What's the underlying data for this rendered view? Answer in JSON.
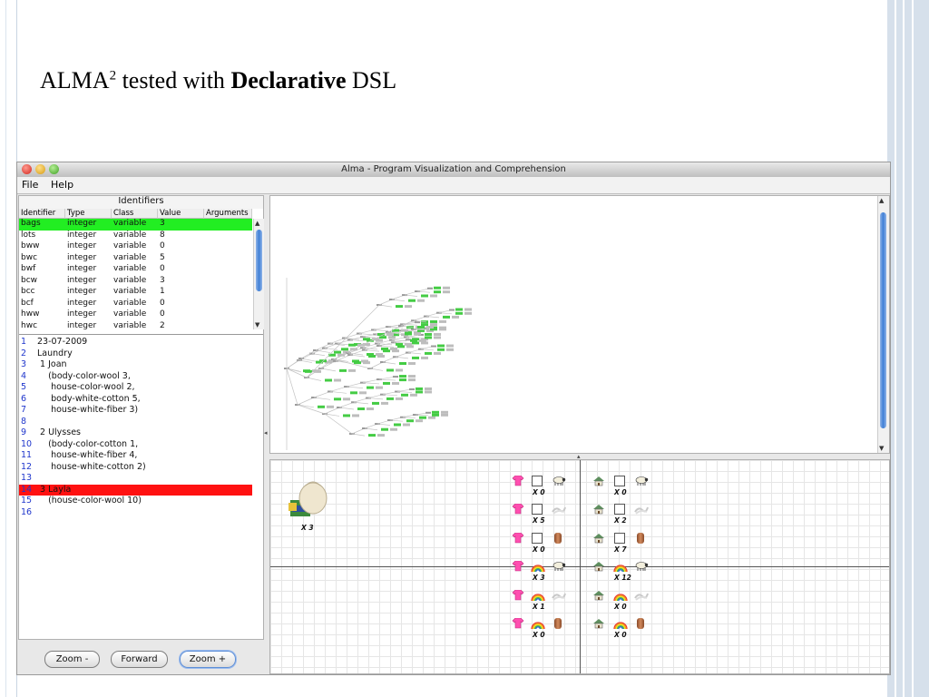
{
  "slide": {
    "title_pre": "ALMA",
    "title_sup": "2",
    "title_mid": " tested with ",
    "title_bold": "Declarative",
    "title_post": " DSL"
  },
  "window": {
    "title": "Alma - Program Visualization and Comprehension",
    "menu": [
      "File",
      "Help"
    ]
  },
  "identifiers": {
    "header": "Identifiers",
    "columns": [
      "Identifier",
      "Type",
      "Class",
      "Value",
      "Arguments"
    ],
    "rows": [
      {
        "id": "bags",
        "type": "integer",
        "class": "variable",
        "value": "3",
        "selected": true
      },
      {
        "id": "lots",
        "type": "integer",
        "class": "variable",
        "value": "8"
      },
      {
        "id": "bww",
        "type": "integer",
        "class": "variable",
        "value": "0"
      },
      {
        "id": "bwc",
        "type": "integer",
        "class": "variable",
        "value": "5"
      },
      {
        "id": "bwf",
        "type": "integer",
        "class": "variable",
        "value": "0"
      },
      {
        "id": "bcw",
        "type": "integer",
        "class": "variable",
        "value": "3"
      },
      {
        "id": "bcc",
        "type": "integer",
        "class": "variable",
        "value": "1"
      },
      {
        "id": "bcf",
        "type": "integer",
        "class": "variable",
        "value": "0"
      },
      {
        "id": "hww",
        "type": "integer",
        "class": "variable",
        "value": "0"
      },
      {
        "id": "hwc",
        "type": "integer",
        "class": "variable",
        "value": "2"
      }
    ]
  },
  "code": {
    "highlight_line": 14,
    "lines": [
      "23-07-2009",
      "Laundry",
      " 1 Joan",
      "    (body-color-wool 3,",
      "     house-color-wool 2,",
      "     body-white-cotton 5,",
      "     house-white-fiber 3)",
      "",
      " 2 Ulysses",
      "    (body-color-cotton 1,",
      "     house-white-fiber 4,",
      "     house-white-cotton 2)",
      "",
      " 3 Layla",
      "    (house-color-wool 10)",
      ""
    ]
  },
  "buttons": {
    "zoom_minus": "Zoom -",
    "forward": "Forward",
    "zoom_plus": "Zoom +"
  },
  "state": {
    "bag_count": "X 3",
    "left_column": [
      "X 0",
      "X 5",
      "X 0",
      "X 3",
      "X 1",
      "X 0"
    ],
    "right_column": [
      "X 0",
      "X 2",
      "X 7",
      "X 12",
      "X 0",
      "X 0"
    ]
  },
  "colors": {
    "selected_row": "#22ee22",
    "highlight_line": "#ff1111",
    "line_numbers": "#1f36cc",
    "scroll_thumb": "#3f7fd6",
    "tree_leaf": "#44cc44"
  },
  "icons": [
    "laundry-bag-icon",
    "shirt-icon",
    "house-icon",
    "white-box-icon",
    "rainbow-icon",
    "sheep-icon",
    "fiber-icon",
    "cotton-roll-icon"
  ]
}
